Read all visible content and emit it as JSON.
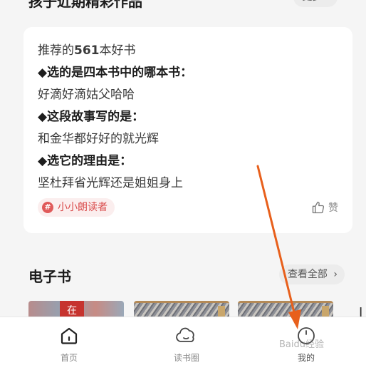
{
  "top_section": {
    "title": "孩子近期精彩作品",
    "more_label": "更多",
    "more_chevron": "›"
  },
  "card": {
    "line1_prefix": "推荐的",
    "line1_count": "561",
    "line1_suffix": "本好书",
    "q1": "◆选的是四本书中的哪本书：",
    "a1": "好滴好滴姑父哈哈",
    "q2": "◆这段故事写的是：",
    "a2": "和金华都好好的就光辉",
    "q3": "◆选它的理由是：",
    "a3": "坚杜拜省光辉还是姐姐身上",
    "tag_label": "小小朗读者",
    "tag_icon": "#",
    "like_label": "赞"
  },
  "ebook": {
    "title": "电子书",
    "view_all_label": "查看全部",
    "chevron": "›",
    "book1_char": "在"
  },
  "tabbar": {
    "home_label": "首页",
    "circle_label": "读书圈",
    "mine_label": "我的"
  },
  "edge_glyph": "I",
  "watermark": "Baidu经验",
  "colors": {
    "accent_red": "#d94a4a",
    "annotation_arrow": "#e8601c",
    "card_bg": "#ffffff",
    "page_bg": "#f5f5f5"
  }
}
